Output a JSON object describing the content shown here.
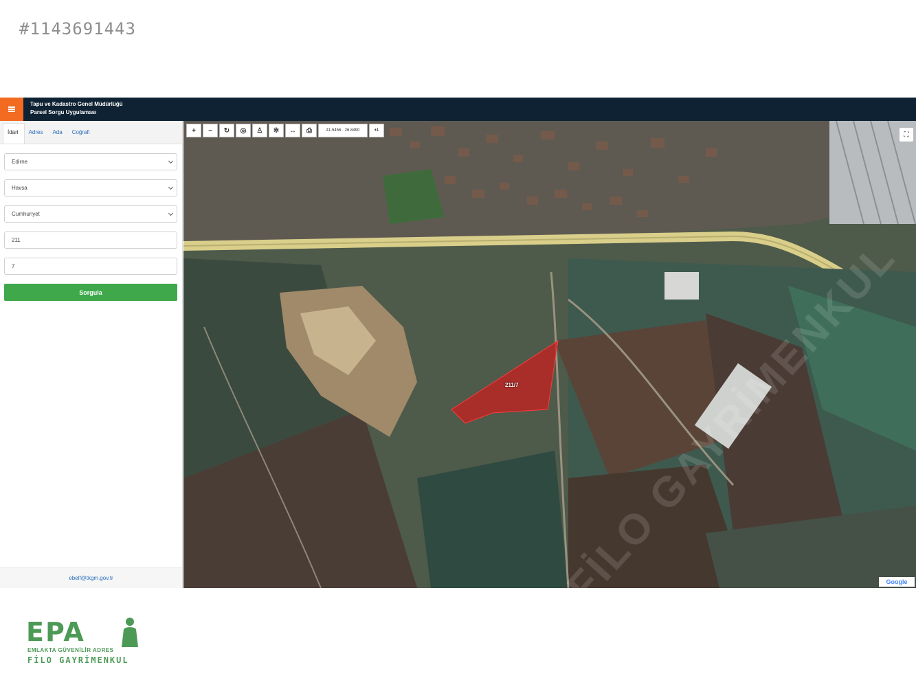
{
  "listing_id": "#1143691443",
  "header": {
    "title_line1": "Tapu ve Kadastro Genel Müdürlüğü",
    "title_line2": "Parsel Sorgu Uygulaması"
  },
  "tabs": [
    {
      "label": "İdari",
      "active": true
    },
    {
      "label": "Adres",
      "active": false
    },
    {
      "label": "Ada",
      "active": false
    },
    {
      "label": "Coğrafi",
      "active": false
    }
  ],
  "form": {
    "province": "Edirne",
    "district": "Havsa",
    "neighborhood": "Cumhuriyet",
    "block": "211",
    "parcel": "7",
    "submit_label": "Sorgula"
  },
  "footer_link": "ebelf@tkgm.gov.tr",
  "map": {
    "coordinates": "41.5456 · 26.8490",
    "scale_label": "±1",
    "parcel_label": "211/7",
    "watermark": "EPA FİLO GAYRİMENKUL",
    "attribution": "Google",
    "colors": {
      "parcel_fill": "#c81f1f",
      "road": "#d9cf8a"
    }
  },
  "toolbar_icons": [
    "plus-icon",
    "minus-icon",
    "rotate-icon",
    "locate-icon",
    "person-icon",
    "gear-icon",
    "measure-icon",
    "print-icon"
  ],
  "logo": {
    "mark": "EPA",
    "tagline": "EMLAKTA GÜVENİLİR ADRES",
    "company": "FİLO GAYRİMENKUL"
  }
}
